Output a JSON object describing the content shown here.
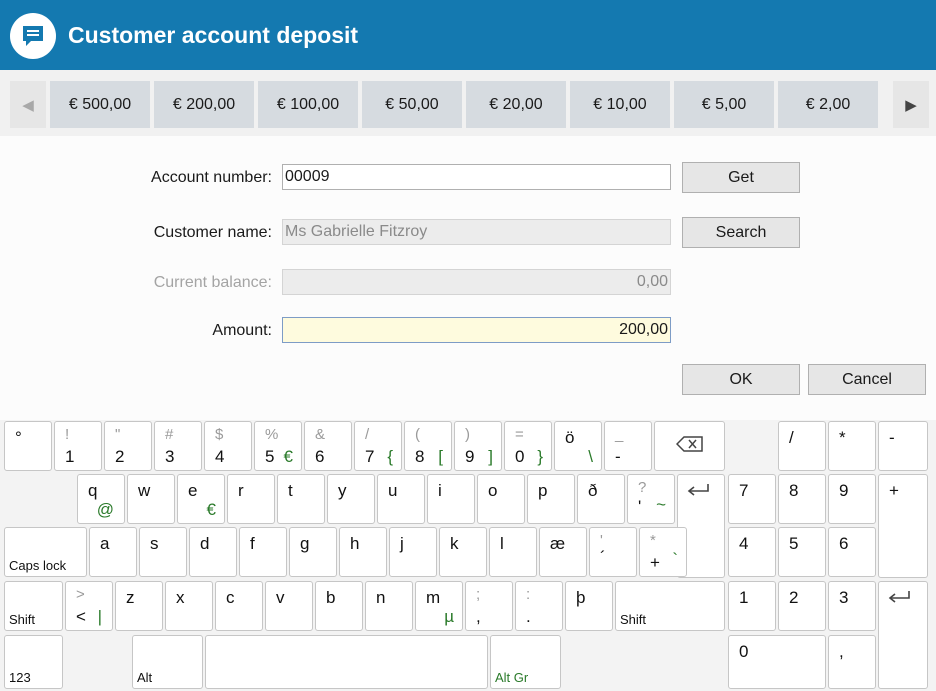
{
  "header": {
    "title": "Customer account deposit",
    "icon": "chat-bubble-icon",
    "color": "#1479b0"
  },
  "strip": {
    "nav_left": "◀",
    "nav_right": "▶",
    "denominations": [
      "€ 500,00",
      "€ 200,00",
      "€ 100,00",
      "€ 50,00",
      "€ 20,00",
      "€ 10,00",
      "€ 5,00",
      "€ 2,00"
    ]
  },
  "form": {
    "account_label": "Account number:",
    "account_value": "00009",
    "get_label": "Get",
    "name_label": "Customer name:",
    "name_value": "Ms Gabrielle Fitzroy",
    "search_label": "Search",
    "balance_label": "Current balance:",
    "balance_value": "0,00",
    "amount_label": "Amount:",
    "amount_value": "200,00",
    "ok_label": "OK",
    "cancel_label": "Cancel"
  },
  "keyboard": {
    "row1": [
      {
        "main": "°",
        "shift": "",
        "alt": ""
      },
      {
        "main": "1",
        "shift": "!",
        "alt": ""
      },
      {
        "main": "2",
        "shift": "\"",
        "alt": ""
      },
      {
        "main": "3",
        "shift": "#",
        "alt": ""
      },
      {
        "main": "4",
        "shift": "$",
        "alt": ""
      },
      {
        "main": "5",
        "shift": "%",
        "alt": "€"
      },
      {
        "main": "6",
        "shift": "&",
        "alt": ""
      },
      {
        "main": "7",
        "shift": "/",
        "alt": "{"
      },
      {
        "main": "8",
        "shift": "(",
        "alt": "["
      },
      {
        "main": "9",
        "shift": ")",
        "alt": "]"
      },
      {
        "main": "0",
        "shift": "=",
        "alt": "}"
      },
      {
        "main": "ö",
        "shift": "",
        "alt": "\\"
      },
      {
        "main": "-",
        "shift": "_",
        "alt": ""
      }
    ],
    "row2": [
      {
        "main": "q",
        "alt": "@"
      },
      {
        "main": "w",
        "alt": ""
      },
      {
        "main": "e",
        "alt": "€"
      },
      {
        "main": "r",
        "alt": ""
      },
      {
        "main": "t",
        "alt": ""
      },
      {
        "main": "y",
        "alt": ""
      },
      {
        "main": "u",
        "alt": ""
      },
      {
        "main": "i",
        "alt": ""
      },
      {
        "main": "o",
        "alt": ""
      },
      {
        "main": "p",
        "alt": ""
      },
      {
        "main": "ð",
        "alt": ""
      },
      {
        "main": "'",
        "shift": "?",
        "alt": "~"
      }
    ],
    "row3": [
      {
        "main": "a"
      },
      {
        "main": "s"
      },
      {
        "main": "d"
      },
      {
        "main": "f"
      },
      {
        "main": "g"
      },
      {
        "main": "h"
      },
      {
        "main": "j"
      },
      {
        "main": "k"
      },
      {
        "main": "l"
      },
      {
        "main": "æ"
      },
      {
        "main": "´",
        "shift": "'"
      },
      {
        "main": "+",
        "shift": "*",
        "alt": "`"
      }
    ],
    "row4": [
      {
        "main": "<",
        "shift": ">",
        "alt": "|"
      },
      {
        "main": "z"
      },
      {
        "main": "x"
      },
      {
        "main": "c"
      },
      {
        "main": "v"
      },
      {
        "main": "b"
      },
      {
        "main": "n"
      },
      {
        "main": "m",
        "alt": "µ"
      },
      {
        "main": ",",
        "shift": ";"
      },
      {
        "main": ".",
        "shift": ":"
      },
      {
        "main": "þ"
      }
    ],
    "caps_lock": "Caps lock",
    "shift": "Shift",
    "num_toggle": "123",
    "alt": "Alt",
    "alt_gr": "Alt Gr",
    "numpad": {
      "slash": "/",
      "star": "*",
      "minus": "-",
      "plus": "+",
      "n7": "7",
      "n8": "8",
      "n9": "9",
      "n4": "4",
      "n5": "5",
      "n6": "6",
      "n1": "1",
      "n2": "2",
      "n3": "3",
      "n0": "0",
      "comma": ","
    }
  }
}
